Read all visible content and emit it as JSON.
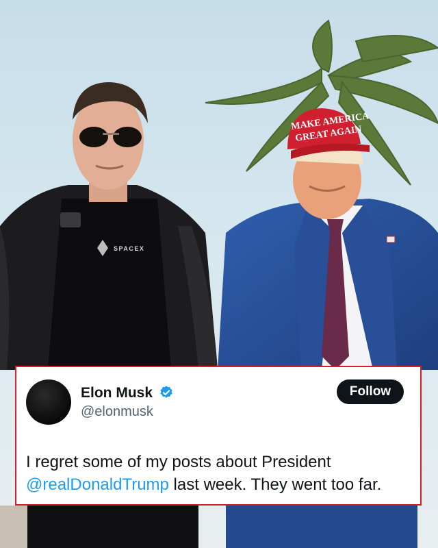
{
  "photo": {
    "cap_text_line1": "MAKE AMERICA",
    "cap_text_line2": "GREAT AGAIN",
    "shirt_logo_text": "SPACEX"
  },
  "tweet": {
    "display_name": "Elon Musk",
    "handle": "@elonmusk",
    "follow_label": "Follow",
    "text_part1": "I regret some of my posts about President",
    "mention": "@realDonaldTrump",
    "text_part2": " last week. They went too far.",
    "verified": true,
    "colors": {
      "card_border": "#d21f2a",
      "mention": "#1d9bf0",
      "verified_badge": "#1d9bf0",
      "follow_button": "#0f1419"
    }
  }
}
